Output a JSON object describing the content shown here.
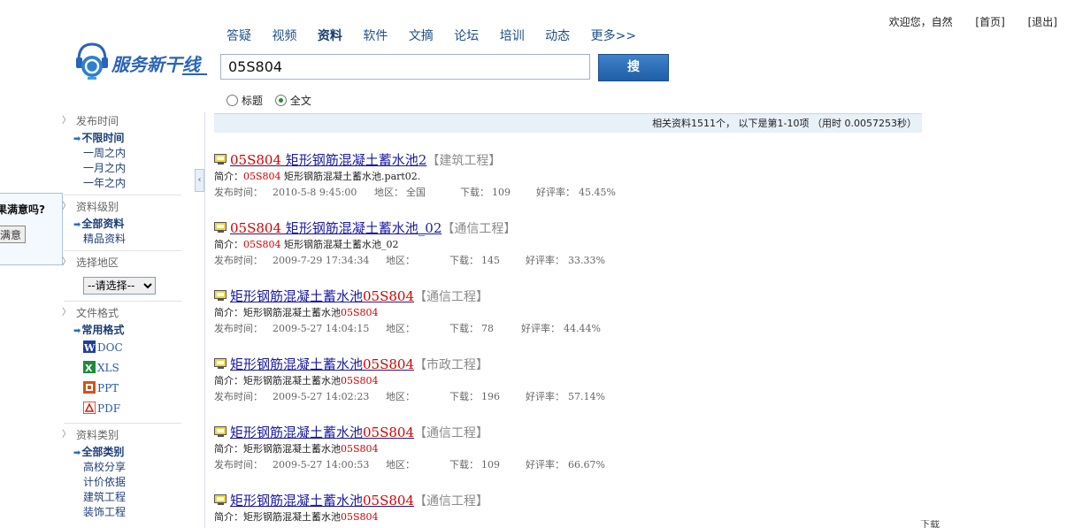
{
  "userbar": {
    "welcome": "欢迎您，自然",
    "home": "[首页]",
    "logout": "[退出]"
  },
  "logo": {
    "text": "服务新干线"
  },
  "nav": {
    "items": [
      "答疑",
      "视频",
      "资料",
      "软件",
      "文摘",
      "论坛",
      "培训",
      "动态",
      "更多>>"
    ],
    "active": "资料"
  },
  "search": {
    "value": "05S804",
    "button": "搜 索",
    "opt_title": "标题",
    "opt_full": "全文",
    "selected": "全文"
  },
  "stats": {
    "text": "相关资料1511个， 以下是第1-10项 （用时 0.0057253秒）"
  },
  "feedback": {
    "question": "果满意吗?",
    "button": "满意"
  },
  "sidebar": {
    "time": {
      "head": "发布时间",
      "items": [
        "不限时间",
        "一周之内",
        "一月之内",
        "一年之内"
      ]
    },
    "level": {
      "head": "资料级别",
      "items": [
        "全部资料",
        "精品资料"
      ]
    },
    "region": {
      "head": "选择地区",
      "select": "--请选择--"
    },
    "format": {
      "head": "文件格式",
      "common": "常用格式",
      "items": [
        "DOC",
        "XLS",
        "PPT",
        "PDF"
      ]
    },
    "category": {
      "head": "资料类别",
      "items": [
        "全部类别",
        "高校分享",
        "计价依据",
        "建筑工程",
        "装饰工程"
      ]
    }
  },
  "results": [
    {
      "t1": "05S804",
      "t2": " 矩形钢筋混凝土蓄水池2",
      "cat": "【建筑工程】",
      "s1": "05S804",
      "s2": " 矩形钢筋混凝土蓄水池.part02.",
      "sum_label": "简介：",
      "date_label": "发布时间：",
      "date": "2010-5-8 9:45:00",
      "region_label": "地区：",
      "region": "全国",
      "dl_label": "下载：",
      "dl": "109",
      "rate_label": "好评率：",
      "rate": "45.45%"
    },
    {
      "t1": "05S804",
      "t2": " 矩形钢筋混凝土蓄水池_02",
      "cat": "【通信工程】",
      "s1": "05S804",
      "s2": " 矩形钢筋混凝土蓄水池_02",
      "sum_label": "简介：",
      "date_label": "发布时间：",
      "date": "2009-7-29 17:34:34",
      "region_label": "地区：",
      "region": "",
      "dl_label": "下载：",
      "dl": "145",
      "rate_label": "好评率：",
      "rate": "33.33%"
    },
    {
      "t1": "矩形钢筋混凝土蓄水池",
      "t2": "05S804",
      "cat": "【通信工程】",
      "s1": "矩形钢筋混凝土蓄水池",
      "s2": "05S804",
      "sum_label": "简介：",
      "date_label": "发布时间：",
      "date": "2009-5-27 14:04:15",
      "region_label": "地区：",
      "region": "",
      "dl_label": "下载：",
      "dl": "78",
      "rate_label": "好评率：",
      "rate": "44.44%"
    },
    {
      "t1": "矩形钢筋混凝土蓄水池",
      "t2": "05S804",
      "cat": "【市政工程】",
      "s1": "矩形钢筋混凝土蓄水池",
      "s2": "05S804",
      "sum_label": "简介：",
      "date_label": "发布时间：",
      "date": "2009-5-27 14:02:23",
      "region_label": "地区：",
      "region": "",
      "dl_label": "下载：",
      "dl": "196",
      "rate_label": "好评率：",
      "rate": "57.14%"
    },
    {
      "t1": "矩形钢筋混凝土蓄水池",
      "t2": "05S804",
      "cat": "【通信工程】",
      "s1": "矩形钢筋混凝土蓄水池",
      "s2": "05S804",
      "sum_label": "简介：",
      "date_label": "发布时间：",
      "date": "2009-5-27 14:00:53",
      "region_label": "地区：",
      "region": "",
      "dl_label": "下载：",
      "dl": "109",
      "rate_label": "好评率：",
      "rate": "66.67%"
    },
    {
      "t1": "矩形钢筋混凝土蓄水池",
      "t2": "05S804",
      "cat": "【通信工程】",
      "s1": "矩形钢筋混凝土蓄水池",
      "s2": "05S804",
      "sum_label": "简介："
    }
  ],
  "statusbar": {
    "text": "下载"
  }
}
